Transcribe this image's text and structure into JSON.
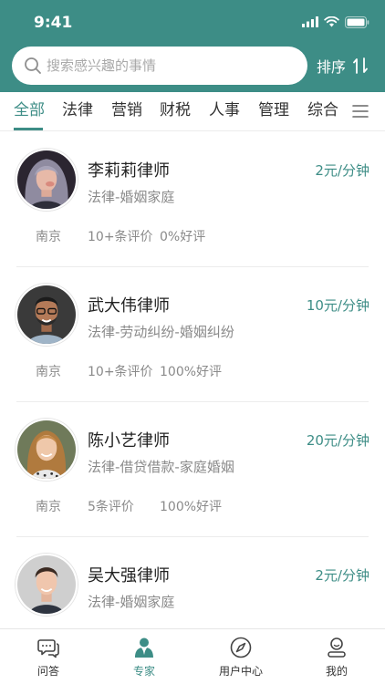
{
  "status_bar": {
    "time": "9:41"
  },
  "search": {
    "placeholder": "搜索感兴趣的事情",
    "value": ""
  },
  "sort": {
    "label": "排序"
  },
  "tabs": [
    {
      "label": "全部",
      "active": true
    },
    {
      "label": "法律",
      "active": false
    },
    {
      "label": "营销",
      "active": false
    },
    {
      "label": "财税",
      "active": false
    },
    {
      "label": "人事",
      "active": false
    },
    {
      "label": "管理",
      "active": false
    },
    {
      "label": "综合",
      "active": false
    }
  ],
  "lawyers": [
    {
      "name": "李莉莉律师",
      "price": "2元/分钟",
      "category": "法律-婚姻家庭",
      "city": "南京",
      "reviews": "10+条评价",
      "rating": "0%好评"
    },
    {
      "name": "武大伟律师",
      "price": "10元/分钟",
      "category": "法律-劳动纠纷-婚姻纠纷",
      "city": "南京",
      "reviews": "10+条评价",
      "rating": "100%好评"
    },
    {
      "name": "陈小艺律师",
      "price": "20元/分钟",
      "category": "法律-借贷借款-家庭婚姻",
      "city": "南京",
      "reviews": "5条评价",
      "rating": "100%好评"
    },
    {
      "name": "吴大强律师",
      "price": "2元/分钟",
      "category": "法律-婚姻家庭",
      "city": "",
      "reviews": "",
      "rating": ""
    }
  ],
  "tabbar": [
    {
      "label": "问答",
      "icon": "chat-bubble-icon",
      "active": false
    },
    {
      "label": "专家",
      "icon": "expert-icon",
      "active": true
    },
    {
      "label": "用户中心",
      "icon": "compass-icon",
      "active": false
    },
    {
      "label": "我的",
      "icon": "profile-icon",
      "active": false
    }
  ],
  "colors": {
    "primary": "#3d8d86",
    "text": "#222222",
    "muted": "#8a8a8a"
  }
}
